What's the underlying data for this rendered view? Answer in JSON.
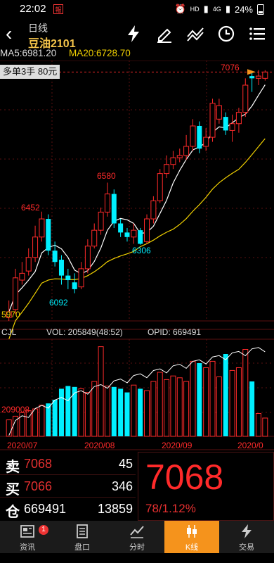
{
  "status_bar": {
    "time": "22:02",
    "notif_icon": "news-app-icon",
    "network": "HD",
    "signal_label": "4G",
    "battery": "24%"
  },
  "header": {
    "title_small": "日线",
    "title_main": "豆油2101"
  },
  "ma": {
    "ma5": "MA5:6981.20",
    "ma20": "MA20:6728.70"
  },
  "positions": {
    "label": "多单3手  80元"
  },
  "chart_labels": {
    "top_price": "7076",
    "open_line_text": "7068",
    "bottom_price": "5970",
    "hi1": "6452",
    "hi2": "6580",
    "lo1": "6092",
    "lo2": "6306",
    "cjl": "CJL",
    "vol": "VOL: 205849(48:52)",
    "opid": "OPID: 669491",
    "vol_axis_label": "209008",
    "x_axis": [
      "2020/07",
      "2020/08",
      "2020/09",
      "2020/0"
    ]
  },
  "chart_data": {
    "type": "candlestick",
    "price_range": [
      5970,
      7100
    ],
    "x_axis_labels": [
      "2020/07",
      "2020/08",
      "2020/09",
      "2020/0"
    ],
    "candles": [
      {
        "o": 5985,
        "c": 6010,
        "h": 6060,
        "l": 5970,
        "dir": "up"
      },
      {
        "o": 6020,
        "c": 6160,
        "h": 6200,
        "l": 6000,
        "dir": "up"
      },
      {
        "o": 6150,
        "c": 6180,
        "h": 6230,
        "l": 6130,
        "dir": "up"
      },
      {
        "o": 6190,
        "c": 6250,
        "h": 6290,
        "l": 6170,
        "dir": "up"
      },
      {
        "o": 6250,
        "c": 6340,
        "h": 6390,
        "l": 6230,
        "dir": "up"
      },
      {
        "o": 6340,
        "c": 6420,
        "h": 6452,
        "l": 6320,
        "dir": "up"
      },
      {
        "o": 6420,
        "c": 6280,
        "h": 6440,
        "l": 6260,
        "dir": "down"
      },
      {
        "o": 6280,
        "c": 6230,
        "h": 6320,
        "l": 6210,
        "dir": "down"
      },
      {
        "o": 6240,
        "c": 6170,
        "h": 6260,
        "l": 6130,
        "dir": "down"
      },
      {
        "o": 6170,
        "c": 6150,
        "h": 6200,
        "l": 6110,
        "dir": "down"
      },
      {
        "o": 6110,
        "c": 6140,
        "h": 6180,
        "l": 6092,
        "dir": "down"
      },
      {
        "o": 6120,
        "c": 6200,
        "h": 6230,
        "l": 6110,
        "dir": "up"
      },
      {
        "o": 6200,
        "c": 6300,
        "h": 6330,
        "l": 6180,
        "dir": "up"
      },
      {
        "o": 6300,
        "c": 6370,
        "h": 6400,
        "l": 6290,
        "dir": "up"
      },
      {
        "o": 6370,
        "c": 6450,
        "h": 6470,
        "l": 6350,
        "dir": "up"
      },
      {
        "o": 6450,
        "c": 6530,
        "h": 6580,
        "l": 6430,
        "dir": "up"
      },
      {
        "o": 6530,
        "c": 6400,
        "h": 6550,
        "l": 6380,
        "dir": "down"
      },
      {
        "o": 6400,
        "c": 6360,
        "h": 6420,
        "l": 6340,
        "dir": "down"
      },
      {
        "o": 6360,
        "c": 6340,
        "h": 6380,
        "l": 6320,
        "dir": "down"
      },
      {
        "o": 6340,
        "c": 6370,
        "h": 6400,
        "l": 6310,
        "dir": "up"
      },
      {
        "o": 6370,
        "c": 6310,
        "h": 6380,
        "l": 6306,
        "dir": "down"
      },
      {
        "o": 6320,
        "c": 6420,
        "h": 6440,
        "l": 6310,
        "dir": "up"
      },
      {
        "o": 6420,
        "c": 6500,
        "h": 6520,
        "l": 6400,
        "dir": "up"
      },
      {
        "o": 6500,
        "c": 6620,
        "h": 6640,
        "l": 6490,
        "dir": "up"
      },
      {
        "o": 6620,
        "c": 6660,
        "h": 6700,
        "l": 6600,
        "dir": "up"
      },
      {
        "o": 6660,
        "c": 6690,
        "h": 6720,
        "l": 6640,
        "dir": "up"
      },
      {
        "o": 6690,
        "c": 6700,
        "h": 6730,
        "l": 6670,
        "dir": "up"
      },
      {
        "o": 6700,
        "c": 6740,
        "h": 6790,
        "l": 6680,
        "dir": "up"
      },
      {
        "o": 6740,
        "c": 6830,
        "h": 6860,
        "l": 6720,
        "dir": "up"
      },
      {
        "o": 6830,
        "c": 6730,
        "h": 6850,
        "l": 6710,
        "dir": "down"
      },
      {
        "o": 6740,
        "c": 6780,
        "h": 6820,
        "l": 6720,
        "dir": "up"
      },
      {
        "o": 6780,
        "c": 6930,
        "h": 6950,
        "l": 6760,
        "dir": "up"
      },
      {
        "o": 6920,
        "c": 6860,
        "h": 6950,
        "l": 6840,
        "dir": "up"
      },
      {
        "o": 6870,
        "c": 6810,
        "h": 6890,
        "l": 6790,
        "dir": "down"
      },
      {
        "o": 6810,
        "c": 6840,
        "h": 6880,
        "l": 6760,
        "dir": "up"
      },
      {
        "o": 6840,
        "c": 6890,
        "h": 6910,
        "l": 6800,
        "dir": "up"
      },
      {
        "o": 6890,
        "c": 7010,
        "h": 7040,
        "l": 6870,
        "dir": "up"
      },
      {
        "o": 7050,
        "c": 7040,
        "h": 7070,
        "l": 6980,
        "dir": "down"
      },
      {
        "o": 7040,
        "c": 7050,
        "h": 7076,
        "l": 7010,
        "dir": "up"
      },
      {
        "o": 7040,
        "c": 7068,
        "h": 7076,
        "l": 7030,
        "dir": "up"
      }
    ],
    "volume": [
      0.18,
      0.22,
      0.26,
      0.28,
      0.3,
      0.34,
      0.36,
      0.4,
      0.52,
      0.55,
      0.54,
      0.52,
      0.48,
      0.6,
      0.98,
      0.55,
      0.54,
      0.52,
      0.48,
      0.56,
      0.52,
      0.5,
      0.6,
      0.7,
      0.62,
      0.66,
      0.64,
      0.6,
      0.82,
      0.8,
      0.75,
      0.82,
      0.65,
      0.9,
      0.72,
      0.75,
      0.95,
      0.6,
      0.25,
      0.2
    ],
    "volume_dir": [
      "up",
      "up",
      "up",
      "up",
      "up",
      "up",
      "down",
      "down",
      "down",
      "down",
      "down",
      "up",
      "up",
      "up",
      "up",
      "up",
      "down",
      "down",
      "down",
      "up",
      "down",
      "up",
      "up",
      "up",
      "up",
      "up",
      "up",
      "up",
      "up",
      "down",
      "up",
      "up",
      "up",
      "down",
      "up",
      "up",
      "up",
      "down",
      "up",
      "up"
    ]
  },
  "quote": {
    "sell_label": "卖",
    "sell_price": "7068",
    "sell_vol": "45",
    "buy_label": "买",
    "buy_price": "7066",
    "buy_vol": "346",
    "oi_label": "仓",
    "oi_value": "669491",
    "oi_vol": "13859",
    "last_price": "7068",
    "change": "78/1.12%"
  },
  "nav": [
    {
      "label": "资讯",
      "icon": "news-icon",
      "badge": "1"
    },
    {
      "label": "盘口",
      "icon": "orderbook-icon"
    },
    {
      "label": "分时",
      "icon": "timeline-icon"
    },
    {
      "label": "K线",
      "icon": "candlestick-icon",
      "active": true
    },
    {
      "label": "交易",
      "icon": "lightning-icon"
    }
  ],
  "colors": {
    "up": "#ff2a2a",
    "down": "#00f0ff",
    "ma5": "#ffffff",
    "ma20": "#f0d000"
  }
}
